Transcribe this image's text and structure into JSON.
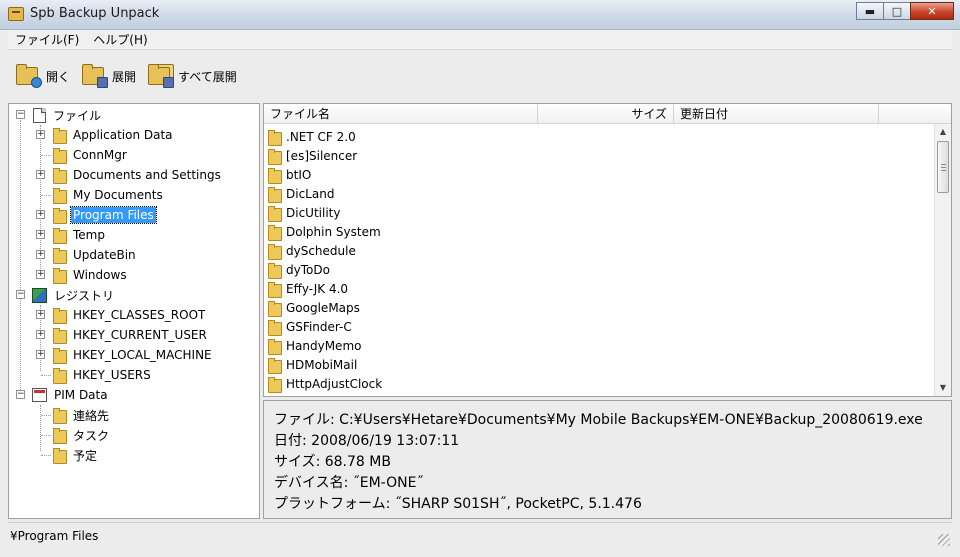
{
  "window": {
    "title": "Spb Backup Unpack",
    "minimize": "▬",
    "maximize": "□",
    "close": "✕"
  },
  "menu": [
    "ファイル(F)",
    "ヘルプ(H)"
  ],
  "toolbar": [
    {
      "label": "開く",
      "icon": "folder-open-icon"
    },
    {
      "label": "展開",
      "icon": "folder-extract-icon"
    },
    {
      "label": "すべて展開",
      "icon": "folder-extract-all-icon"
    }
  ],
  "tree": {
    "files_label": "ファイル",
    "files_children": [
      "Application Data",
      "ConnMgr",
      "Documents and Settings",
      "My Documents",
      "Program Files",
      "Temp",
      "UpdateBin",
      "Windows"
    ],
    "selected": "Program Files",
    "registry_label": "レジストリ",
    "registry_children": [
      "HKEY_CLASSES_ROOT",
      "HKEY_CURRENT_USER",
      "HKEY_LOCAL_MACHINE",
      "HKEY_USERS"
    ],
    "pim_label": "PIM Data",
    "pim_children": [
      "連絡先",
      "タスク",
      "予定"
    ]
  },
  "list": {
    "headers": {
      "name": "ファイル名",
      "size": "サイズ",
      "date": "更新日付"
    },
    "items": [
      ".NET CF 2.0",
      "[es]Silencer",
      "btIO",
      "DicLand",
      "DicUtility",
      "Dolphin System",
      "dySchedule",
      "dyToDo",
      "Effy-JK 4.0",
      "GoogleMaps",
      "GSFinder-C",
      "HandyMemo",
      "HDMobiMail",
      "HttpAdjustClock"
    ]
  },
  "info": {
    "file": "ファイル: C:¥Users¥Hetare¥Documents¥My Mobile Backups¥EM-ONE¥Backup_20080619.exe",
    "date": "日付: 2008/06/19 13:07:11",
    "size": "サイズ: 68.78 MB",
    "device": "デバイス名: ˝EM-ONE˝",
    "platform": "プラットフォーム: ˝SHARP S01SH˝, PocketPC, 5.1.476"
  },
  "status": "¥Program Files",
  "colors": {
    "selection": "#3399ff",
    "folder": "#efc85a"
  }
}
